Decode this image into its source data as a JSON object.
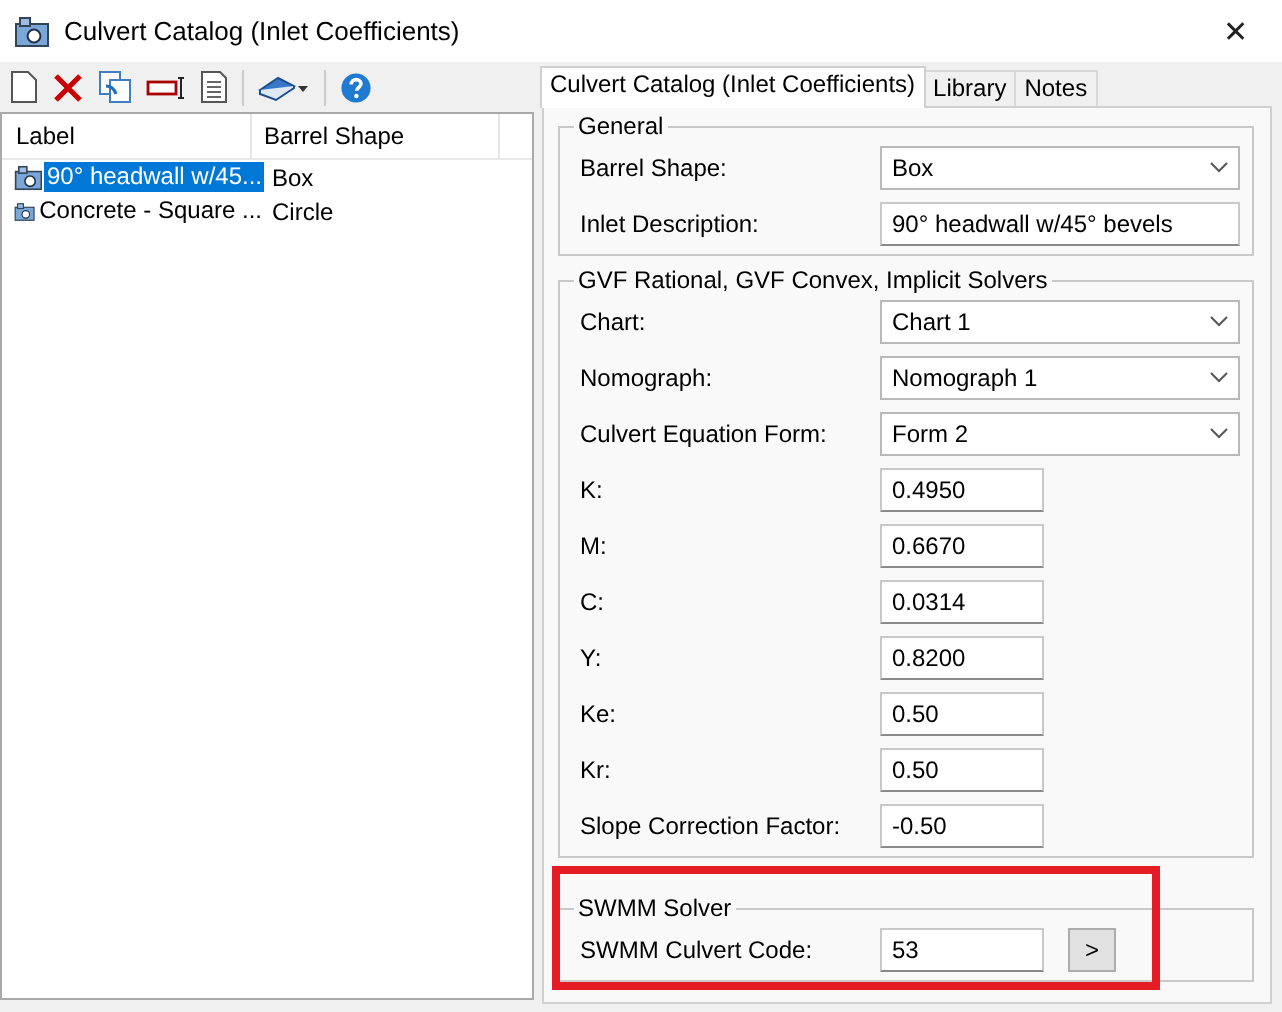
{
  "window": {
    "title": "Culvert Catalog (Inlet Coefficients)",
    "close": "✕"
  },
  "list": {
    "columns": [
      "Label",
      "Barrel Shape"
    ],
    "rows": [
      {
        "label": "90° headwall w/45...",
        "barrel_shape": "Box",
        "selected": true
      },
      {
        "label": "Concrete - Square ...",
        "barrel_shape": "Circle",
        "selected": false
      }
    ]
  },
  "tabs": [
    {
      "label": "Culvert Catalog (Inlet Coefficients)",
      "selected": true
    },
    {
      "label": "Library",
      "selected": false
    },
    {
      "label": "Notes",
      "selected": false
    }
  ],
  "groups": [
    {
      "title": "General",
      "highlighted": false,
      "fields": [
        {
          "kind": "combo",
          "label": "Barrel Shape:",
          "value": "Box"
        },
        {
          "kind": "wide-text",
          "label": "Inlet Description:",
          "value": "90° headwall w/45° bevels"
        }
      ]
    },
    {
      "title": "GVF Rational, GVF Convex, Implicit Solvers",
      "highlighted": false,
      "fields": [
        {
          "kind": "combo",
          "label": "Chart:",
          "value": "Chart 1"
        },
        {
          "kind": "combo",
          "label": "Nomograph:",
          "value": "Nomograph 1"
        },
        {
          "kind": "combo",
          "label": "Culvert Equation Form:",
          "value": "Form 2"
        },
        {
          "kind": "text",
          "label": "K:",
          "value": "0.4950"
        },
        {
          "kind": "text",
          "label": "M:",
          "value": "0.6670"
        },
        {
          "kind": "text",
          "label": "C:",
          "value": "0.0314"
        },
        {
          "kind": "text",
          "label": "Y:",
          "value": "0.8200"
        },
        {
          "kind": "text",
          "label": "Ke:",
          "value": "0.50"
        },
        {
          "kind": "text",
          "label": "Kr:",
          "value": "0.50"
        },
        {
          "kind": "text",
          "label": "Slope Correction Factor:",
          "value": "-0.50"
        }
      ]
    },
    {
      "title": "SWMM Solver",
      "highlighted": true,
      "fields": [
        {
          "kind": "text-button",
          "label": "SWMM Culvert Code:",
          "value": "53",
          "button": ">"
        }
      ]
    }
  ]
}
